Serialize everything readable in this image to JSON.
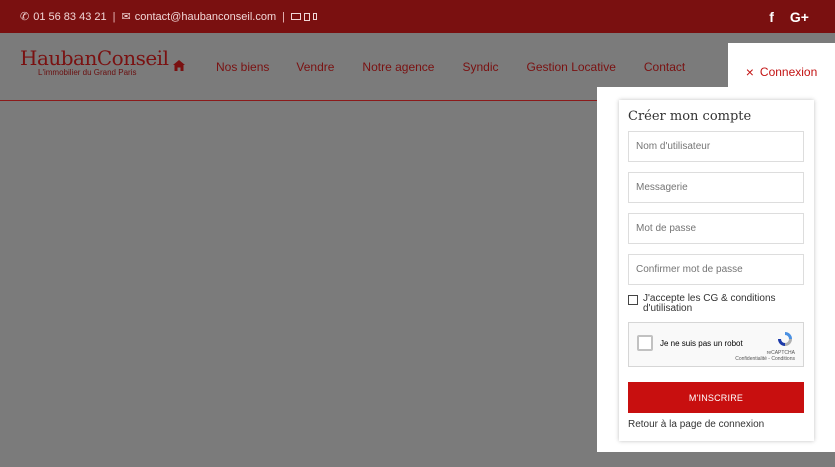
{
  "topbar": {
    "phone": "01 56 83 43 21",
    "email": "contact@haubanconseil.com",
    "social": [
      "f",
      "G+"
    ]
  },
  "logo": {
    "name": "HaubanConseil",
    "tagline": "L'immobilier du Grand Paris"
  },
  "nav": {
    "home_icon": "home-icon",
    "items": [
      "Nos biens",
      "Vendre",
      "Notre agence",
      "Syndic",
      "Gestion Locative",
      "Contact"
    ]
  },
  "connexion": {
    "label": "Connexion",
    "icon": "close-icon"
  },
  "form": {
    "title": "Créer mon compte",
    "username_placeholder": "Nom d'utilisateur",
    "email_placeholder": "Messagerie",
    "password_placeholder": "Mot de passe",
    "confirm_placeholder": "Confirmer mot de passe",
    "accept_line1": "J'accepte les CG & conditions",
    "accept_line2": "d'utilisation",
    "captcha_label": "Je ne suis pas un robot",
    "captcha_brand": "reCAPTCHA",
    "captcha_links": "Confidentialité - Conditions",
    "submit": "M'INSCRIRE",
    "back_link": "Retour à la page de connexion"
  },
  "colors": {
    "brand": "#7a1010",
    "accent": "#c80f0f",
    "overlay": "#7b7b7b"
  }
}
